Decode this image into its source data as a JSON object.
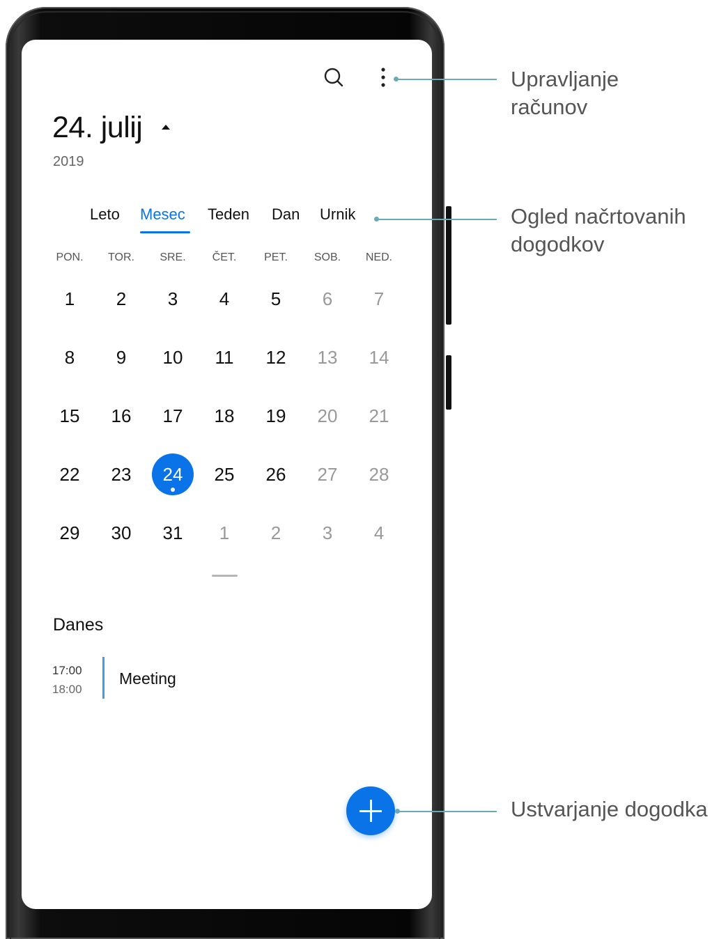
{
  "header": {
    "date_title": "24. julij",
    "year": "2019",
    "search_icon": "search-icon",
    "more_icon": "more-vertical-icon"
  },
  "tabs": [
    {
      "label": "Leto",
      "active": false
    },
    {
      "label": "Mesec",
      "active": true
    },
    {
      "label": "Teden",
      "active": false
    },
    {
      "label": "Dan",
      "active": false
    },
    {
      "label": "Urnik",
      "active": false
    }
  ],
  "weekdays": [
    "PON.",
    "TOR.",
    "SRE.",
    "ČET.",
    "PET.",
    "SOB.",
    "NED."
  ],
  "weeks": [
    [
      "1",
      "2",
      "3",
      "4",
      "5",
      "6",
      "7"
    ],
    [
      "8",
      "9",
      "10",
      "11",
      "12",
      "13",
      "14"
    ],
    [
      "15",
      "16",
      "17",
      "18",
      "19",
      "20",
      "21"
    ],
    [
      "22",
      "23",
      "24",
      "25",
      "26",
      "27",
      "28"
    ],
    [
      "29",
      "30",
      "31",
      "1",
      "2",
      "3",
      "4"
    ]
  ],
  "selected_day": "24",
  "today_section": {
    "heading": "Danes",
    "events": [
      {
        "start": "17:00",
        "end": "18:00",
        "title": "Meeting"
      }
    ]
  },
  "fab_icon": "plus-icon",
  "colors": {
    "accent": "#0a73e8",
    "event_bar": "#3ea0e6",
    "callout": "#6aaab6"
  },
  "callouts": {
    "accounts": "Upravljanje\nračunov",
    "view": "Ogled načrtovanih\ndogodkov",
    "create": "Ustvarjanje dogodka"
  }
}
